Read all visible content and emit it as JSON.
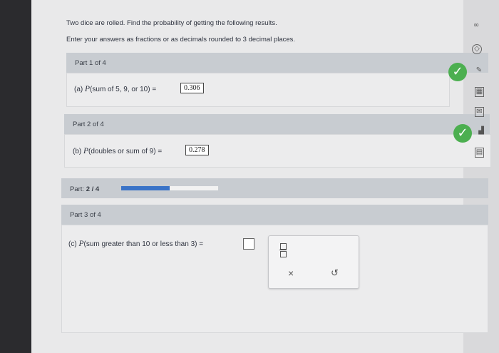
{
  "header": {
    "instruction_1": "Two dice are rolled. Find the probability of getting the following results.",
    "instruction_2": "Enter your answers as fractions or as decimals rounded to 3 decimal places."
  },
  "part1": {
    "label": "Part 1 of 4",
    "prefix": "(a)",
    "p": "P",
    "condition": "(sum of 5, 9, or 10)",
    "equals": "=",
    "answer": "0.306"
  },
  "part2": {
    "label": "Part 2 of 4",
    "prefix": "(b)",
    "p": "P",
    "condition": "(doubles or sum of 9)",
    "equals": "=",
    "answer": "0.278"
  },
  "progress": {
    "label": "Part:",
    "value": "2 / 4",
    "fraction": 0.5
  },
  "part3": {
    "label": "Part 3 of 4",
    "prefix": "(c)",
    "p": "P",
    "condition": "(sum greater than 10 or less than 3)",
    "equals": "=",
    "answer": ""
  },
  "pad": {
    "fraction_icon": "fraction-icon",
    "clear_symbol": "×",
    "undo_symbol": "↺"
  },
  "colors": {
    "check": "#4caf50",
    "progress": "#3a73c7",
    "panel_head": "#c8ccd1"
  }
}
